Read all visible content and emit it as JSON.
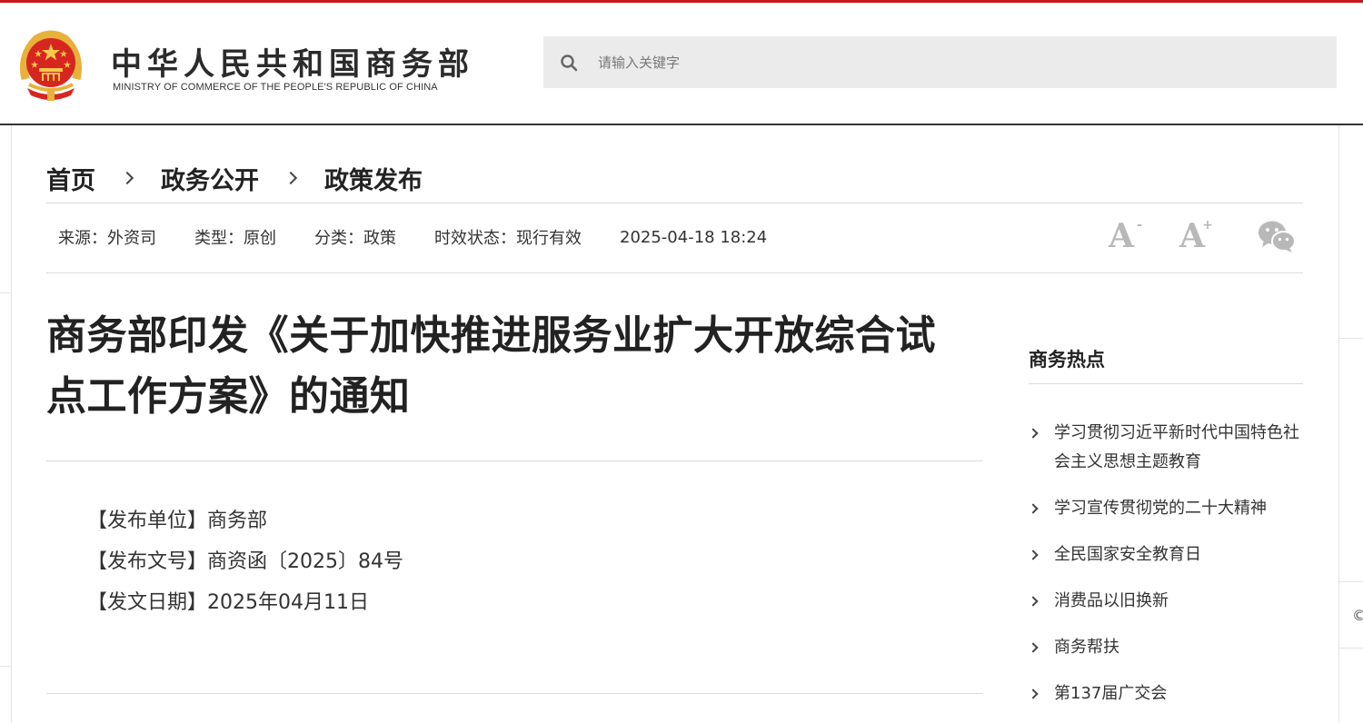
{
  "header": {
    "title": "中华人民共和国商务部",
    "subtitle": "MINISTRY OF COMMERCE OF THE PEOPLE'S REPUBLIC OF CHINA",
    "search_placeholder": "请输入关键字"
  },
  "breadcrumb": {
    "items": [
      "首页",
      "政务公开",
      "政策发布"
    ]
  },
  "meta": {
    "source": "来源：外资司",
    "type": "类型：原创",
    "category": "分类：政策",
    "status": "时效状态：现行有效",
    "datetime": "2025-04-18 18:24"
  },
  "tools": {
    "font_decrease_icon": "font-decrease-icon",
    "font_increase_icon": "font-increase-icon",
    "share_icon": "wechat-icon",
    "font_glyph": "A",
    "decrease_mark": "-",
    "increase_mark": "+"
  },
  "article": {
    "title": "商务部印发《关于加快推进服务业扩大开放综合试点工作方案》的通知",
    "info": [
      "【发布单位】商务部",
      "【发布文号】商资函〔2025〕84号",
      "【发文日期】2025年04月11日"
    ]
  },
  "sidebar": {
    "title": "商务热点",
    "items": [
      "学习贯彻习近平新时代中国特色社会主义思想主题教育",
      "学习宣传贯彻党的二十大精神",
      "全民国家安全教育日",
      "消费品以旧换新",
      "商务帮扶",
      "第137届广交会"
    ]
  },
  "edge_glyph": "©",
  "colors": {
    "accent_red": "#c8161d",
    "emblem_gold": "#e8b13a",
    "tool_gray": "#b8b8b8"
  }
}
